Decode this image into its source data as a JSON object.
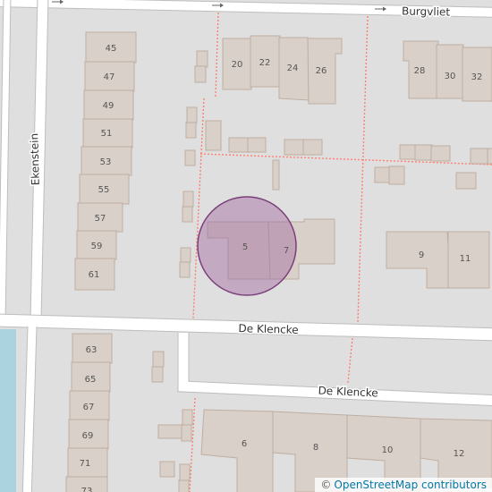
{
  "map": {
    "attribution": {
      "symbol": "©",
      "link_text": "OpenStreetMap contributors"
    },
    "colors": {
      "background": "#e0dfdf",
      "road": "#ffffff",
      "road_casing": "#bdbdbd",
      "building_fill": "#d9d0c9",
      "building_stroke": "#bfaea2",
      "water": "#aad3df",
      "footpath": "#fa8072",
      "marker_fill": "#9f6a9f",
      "marker_stroke": "#7a3f7a",
      "label": "#333333",
      "house_number": "#555555"
    },
    "streets": [
      {
        "name": "Burgvliet"
      },
      {
        "name": "Ekenstein"
      },
      {
        "name": "De Klencke"
      },
      {
        "name": "De Klencke"
      }
    ],
    "house_numbers": [
      "45",
      "47",
      "49",
      "51",
      "53",
      "55",
      "57",
      "59",
      "61",
      "20",
      "22",
      "24",
      "26",
      "28",
      "30",
      "32",
      "5",
      "7",
      "9",
      "11",
      "63",
      "65",
      "67",
      "69",
      "71",
      "73",
      "6",
      "8",
      "10",
      "12"
    ],
    "marker": {
      "type": "location-circle",
      "opacity": 0.45
    }
  }
}
